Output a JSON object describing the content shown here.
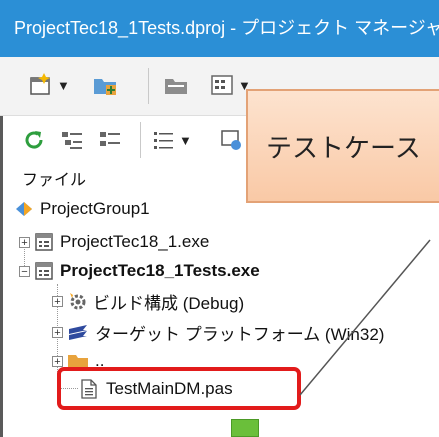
{
  "window": {
    "title": "ProjectTec18_1Tests.dproj - プロジェクト マネージャ"
  },
  "panel": {
    "label": "ファイル"
  },
  "tree": {
    "group": "ProjectGroup1",
    "project1": "ProjectTec18_1.exe",
    "project2": "ProjectTec18_1Tests.exe",
    "build_config": "ビルド構成 (Debug)",
    "target_platform": "ターゲット プラットフォーム (Win32)",
    "folder": "..",
    "file": "TestMainDM.pas"
  },
  "callout": {
    "text": "テストケース"
  },
  "colors": {
    "title_bar": "#2b8fd6",
    "highlight": "#e21b1b",
    "callout_bg": "#fbd5b8"
  }
}
